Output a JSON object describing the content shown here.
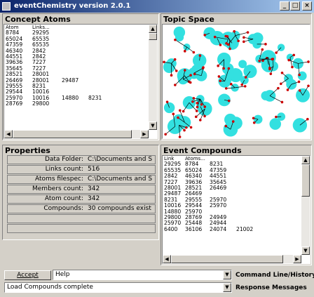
{
  "window": {
    "title": "eventChemistry  version 2.0.1",
    "min_icon": "minimize-icon",
    "max_icon": "maximize-icon",
    "close_icon": "close-icon"
  },
  "concept_atoms": {
    "title": "Concept Atoms",
    "columns": [
      "Atom",
      "Links..."
    ],
    "rows": [
      [
        "8784",
        "29295",
        "",
        ""
      ],
      [
        "65024",
        "65535",
        "",
        ""
      ],
      [
        "47359",
        "65535",
        "",
        ""
      ],
      [
        "46340",
        "2842",
        "",
        ""
      ],
      [
        "44551",
        "2842",
        "",
        ""
      ],
      [
        "39636",
        "7227",
        "",
        ""
      ],
      [
        "35645",
        "7227",
        "",
        ""
      ],
      [
        "28521",
        "28001",
        "",
        ""
      ],
      [
        "26469",
        "28001",
        "29487",
        ""
      ],
      [
        "29555",
        "8231",
        "",
        ""
      ],
      [
        "29544",
        "10016",
        "",
        ""
      ],
      [
        "25970",
        "10016",
        "14880",
        "8231"
      ],
      [
        "28769",
        "29800",
        "",
        ""
      ]
    ]
  },
  "topic_space": {
    "title": "Topic Space",
    "node_color": "#33e0e0",
    "link_color": "#000000",
    "atom_color": "#cc0000"
  },
  "properties": {
    "title": "Properties",
    "rows": [
      {
        "label": "Data Folder:",
        "value": "C:\\Documents and S"
      },
      {
        "label": "Links count:",
        "value": "516"
      },
      {
        "label": "Atoms filespec:",
        "value": "C:\\Documents and S"
      },
      {
        "label": "Members count:",
        "value": "342"
      },
      {
        "label": "Atom count:",
        "value": "342"
      },
      {
        "label": "Compounds:",
        "value": "30 compounds exist"
      },
      {
        "label": "",
        "value": ""
      },
      {
        "label": "",
        "value": ""
      }
    ]
  },
  "event_compounds": {
    "title": "Event Compounds",
    "columns": [
      "Link",
      "Atoms..."
    ],
    "rows": [
      [
        "29295",
        "8784",
        "8231",
        ""
      ],
      [
        "65535",
        "65024",
        "47359",
        ""
      ],
      [
        "2842",
        "46340",
        "44551",
        ""
      ],
      [
        "7227",
        "39636",
        "35645",
        ""
      ],
      [
        "28001",
        "28521",
        "26469",
        ""
      ],
      [
        "29487",
        "26469",
        "",
        ""
      ],
      [
        "8231",
        "29555",
        "25970",
        ""
      ],
      [
        "10016",
        "29544",
        "25970",
        ""
      ],
      [
        "14880",
        "25970",
        "",
        ""
      ],
      [
        "29800",
        "28769",
        "24949",
        ""
      ],
      [
        "25970",
        "25448",
        "24944",
        ""
      ],
      [
        "6400",
        "36106",
        "24074",
        "21002"
      ]
    ]
  },
  "command": {
    "accept_label": "Accept",
    "input_value": "Help",
    "label": "Command Line/History"
  },
  "response": {
    "value": "Load Compounds complete",
    "label": "Response Messages"
  },
  "colors": {
    "titlebar_start": "#0a246a",
    "titlebar_end": "#a6caf0",
    "face": "#d4d0c8"
  }
}
